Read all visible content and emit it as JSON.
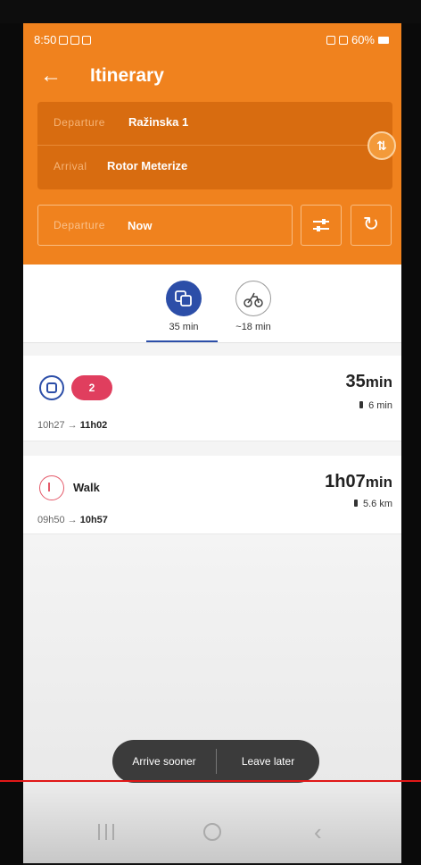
{
  "status_bar": {
    "time": "8:50",
    "battery": "60%"
  },
  "toolbar": {
    "title": "Itinerary"
  },
  "route": {
    "departure_label": "Departure",
    "departure_value": "Ražinska 1",
    "arrival_label": "Arrival",
    "arrival_value": "Rotor Meterize"
  },
  "time_selector": {
    "label": "Departure",
    "value": "Now"
  },
  "modes": [
    {
      "name": "transit",
      "time": "35 min",
      "selected": true
    },
    {
      "name": "bike",
      "time": "~18 min",
      "selected": false
    }
  ],
  "results": [
    {
      "line": "2",
      "depart": "10h27",
      "arrive": "11h02",
      "duration_num": "35",
      "duration_unit": "min",
      "walk": "6 min"
    },
    {
      "label": "Walk",
      "depart": "09h50",
      "arrive": "10h57",
      "duration_num": "1h07",
      "duration_unit": "min",
      "walk": "5.6 km"
    }
  ],
  "time_shift": {
    "sooner": "Arrive sooner",
    "later": "Leave later"
  },
  "colors": {
    "primary": "#f0821e",
    "transit": "#2c4ea8",
    "line_badge": "#e03e5e"
  }
}
